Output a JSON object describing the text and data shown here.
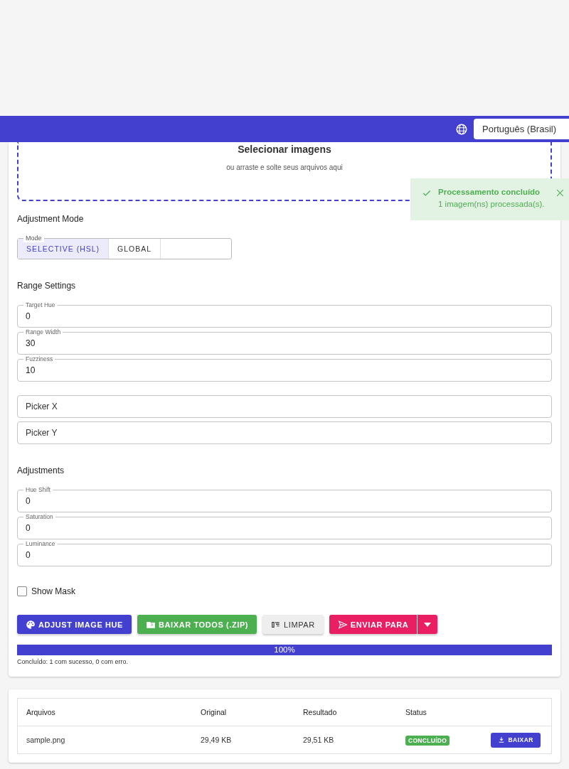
{
  "header": {
    "language_select": {
      "value": "Português (Brasil)"
    }
  },
  "dropzone": {
    "title": "Selecionar imagens",
    "subtitle": "ou arraste e solte seus arquivos aqui"
  },
  "toast": {
    "title": "Processamento concluído",
    "message": "1 imagem(ns) processada(s)."
  },
  "adjustment_mode": {
    "heading": "Adjustment Mode",
    "label": "Mode",
    "options": [
      {
        "label": "SELECTIVE (HSL)",
        "selected": true
      },
      {
        "label": "GLOBAL",
        "selected": false
      }
    ]
  },
  "range_settings": {
    "heading": "Range Settings",
    "fields": [
      {
        "label": "Target Hue",
        "value": "0"
      },
      {
        "label": "Range Width",
        "value": "30"
      },
      {
        "label": "Fuzziness",
        "value": "10"
      }
    ]
  },
  "picker_fields": [
    {
      "placeholder": "Picker X"
    },
    {
      "placeholder": "Picker Y"
    }
  ],
  "adjustments": {
    "heading": "Adjustments",
    "fields": [
      {
        "label": "Hue Shift",
        "value": "0"
      },
      {
        "label": "Saturation",
        "value": "0"
      },
      {
        "label": "Luminance",
        "value": "0"
      }
    ]
  },
  "show_mask": {
    "label": "Show Mask",
    "checked": false
  },
  "actions": [
    {
      "label": "ADJUST IMAGE HUE",
      "kind": "primary"
    },
    {
      "label": "BAIXAR TODOS (.ZIP)",
      "kind": "success"
    },
    {
      "label": "LIMPAR",
      "kind": "neutral"
    },
    {
      "label": "ENVIAR PARA",
      "kind": "send"
    }
  ],
  "progress": {
    "level": 1,
    "reading": "100%",
    "summary": "Concluído: 1 com sucesso, 0 com erro."
  },
  "table": {
    "columns": [
      "Arquivos",
      "Original",
      "Resultado",
      "Status"
    ],
    "rows": [
      {
        "cells": [
          "sample.png",
          "29,49 KB",
          "29,51 KB"
        ],
        "status": "CONCLUÍDO",
        "action": "BAIXAR"
      }
    ]
  }
}
